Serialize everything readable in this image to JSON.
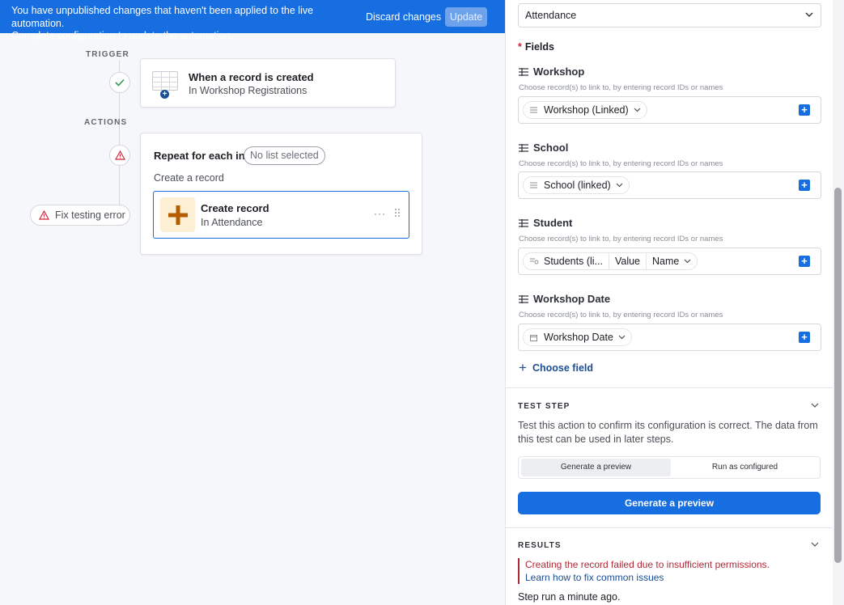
{
  "banner": {
    "message_line1": "You have unpublished changes that haven't been applied to the live automation.",
    "message_line2": "Complete configuration to update the automation.",
    "discard_label": "Discard changes",
    "update_label": "Update"
  },
  "canvas": {
    "trigger_section": "TRIGGER",
    "actions_section": "ACTIONS",
    "trigger_card": {
      "title": "When a record is created",
      "subtitle": "In Workshop Registrations"
    },
    "repeat_card": {
      "title": "Repeat for each in",
      "list_pill": "No list selected",
      "inner_label": "Create a record",
      "action": {
        "title": "Create record",
        "subtitle": "In Attendance",
        "more": "···"
      }
    },
    "fix_error_label": "Fix testing error"
  },
  "panel": {
    "table_select": "Attendance",
    "fields_heading": "Fields",
    "fields_required_mark": "*",
    "fields": [
      {
        "label": "Workshop",
        "hint": "Choose record(s) to link to, by entering record IDs or names",
        "token": "Workshop (Linked)"
      },
      {
        "label": "School",
        "hint": "Choose record(s) to link to, by entering record IDs or names",
        "token": "School (linked)"
      },
      {
        "label": "Student",
        "hint": "Choose record(s) to link to, by entering record IDs or names",
        "token_parts": [
          "Students (li...",
          "Value",
          "Name"
        ]
      },
      {
        "label": "Workshop Date",
        "hint": "Choose record(s) to link to, by entering record IDs or names",
        "token": "Workshop Date"
      }
    ],
    "choose_field_label": "Choose field",
    "test_step": {
      "heading": "TEST STEP",
      "description": "Test this action to confirm its configuration is correct. The data from this test can be used in later steps.",
      "options": [
        "Generate a preview",
        "Run as configured"
      ],
      "selected_option": "Generate a preview",
      "button_label": "Generate a preview"
    },
    "results": {
      "heading": "RESULTS",
      "error": "Creating the record failed due to insufficient permissions.",
      "link": "Learn how to fix common issues",
      "step_run": "Step run a minute ago."
    }
  },
  "colors": {
    "accent": "#166ee1",
    "error": "#b02a37",
    "link": "#1b4e94"
  }
}
